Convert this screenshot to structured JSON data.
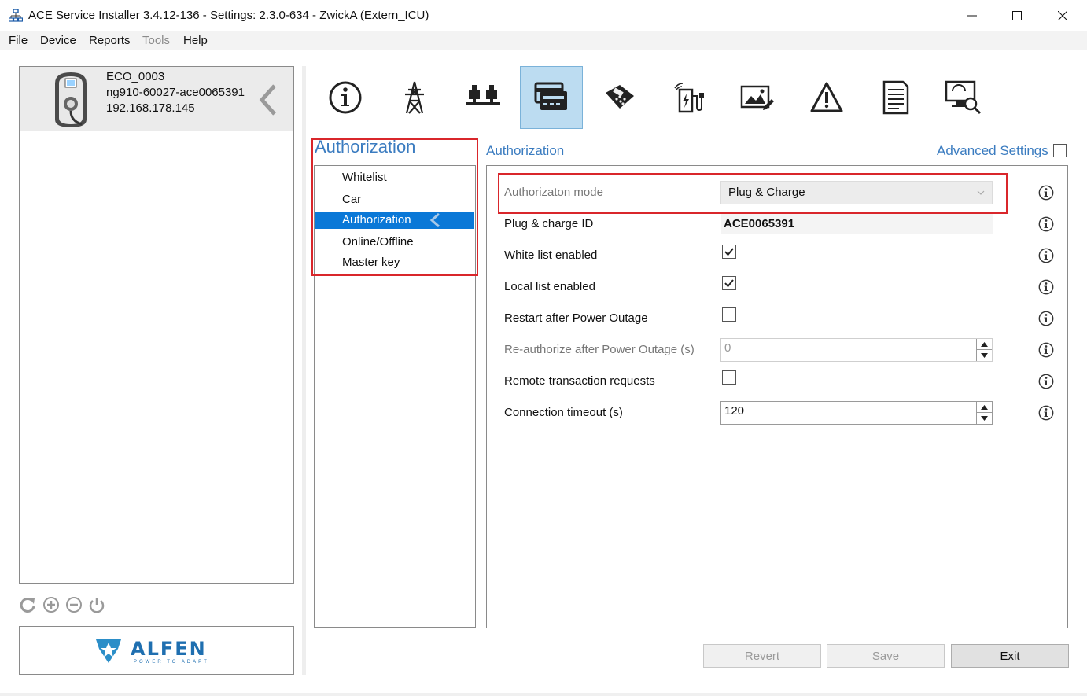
{
  "window": {
    "title": "ACE Service Installer 3.4.12-136 - Settings: 2.3.0-634 - ZwickA (Extern_ICU)",
    "minimize_icon": "minimize-icon",
    "maximize_icon": "maximize-icon",
    "close_icon": "close-icon"
  },
  "menu": {
    "file": "File",
    "device": "Device",
    "reports": "Reports",
    "tools": "Tools",
    "help": "Help"
  },
  "device": {
    "name": "ECO_0003",
    "serial": "ng910-60027-ace0065391",
    "ip": "192.168.178.145"
  },
  "device_toolbar": [
    "refresh-icon",
    "add-icon",
    "remove-icon",
    "power-icon"
  ],
  "logo": {
    "name": "ALFEN",
    "tagline": "POWER TO ADAPT"
  },
  "categories": [
    {
      "icon": "info-icon"
    },
    {
      "icon": "power-tower-icon"
    },
    {
      "icon": "load-balancing-icon"
    },
    {
      "icon": "card-icon",
      "active": true
    },
    {
      "icon": "payment-terminal-icon"
    },
    {
      "icon": "charging-station-icon"
    },
    {
      "icon": "display-icon"
    },
    {
      "icon": "warning-icon"
    },
    {
      "icon": "document-icon"
    },
    {
      "icon": "diagnostics-icon"
    }
  ],
  "subnav": {
    "title": "Authorization",
    "items": [
      "Whitelist",
      "Car",
      "Authorization",
      "Online/Offline",
      "Master key"
    ],
    "selected": "Authorization"
  },
  "settings": {
    "section_title": "Authorization",
    "advanced_label": "Advanced Settings",
    "advanced_checked": false,
    "auth_mode_label": "Authorizaton mode",
    "auth_mode_value": "Plug & Charge",
    "pc_id_label": "Plug & charge ID",
    "pc_id_value": "ACE0065391",
    "whitelist_label": "White list enabled",
    "whitelist_checked": true,
    "locallist_label": "Local list enabled",
    "locallist_checked": true,
    "restart_label": "Restart after Power Outage",
    "restart_checked": false,
    "reauth_label": "Re-authorize after Power Outage (s)",
    "reauth_value": "0",
    "remote_label": "Remote transaction requests",
    "remote_checked": false,
    "timeout_label": "Connection timeout (s)",
    "timeout_value": "120"
  },
  "buttons": {
    "revert": "Revert",
    "save": "Save",
    "exit": "Exit"
  },
  "colors": {
    "accent": "#3b7cc0",
    "selection": "#0a78d7",
    "highlight_box": "#d9262b",
    "active_tab": "#bcdcf1"
  }
}
